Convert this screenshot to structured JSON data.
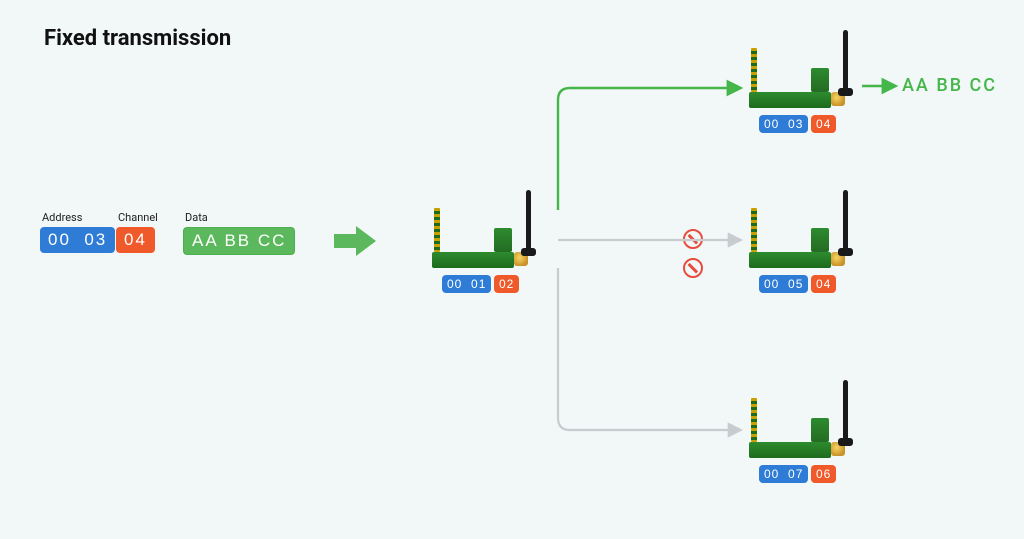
{
  "title": "Fixed transmission",
  "input": {
    "labels": {
      "address": "Address",
      "channel": "Channel",
      "data": "Data"
    },
    "address": "00  03",
    "channel": "04",
    "data": "AA BB CC"
  },
  "sender": {
    "address": "00  01",
    "channel": "02"
  },
  "receivers": [
    {
      "address": "00  03",
      "channel": "04",
      "matched": true
    },
    {
      "address": "00  05",
      "channel": "04",
      "matched": false
    },
    {
      "address": "00  07",
      "channel": "06",
      "matched": false
    }
  ],
  "output_data": "AA BB CC"
}
